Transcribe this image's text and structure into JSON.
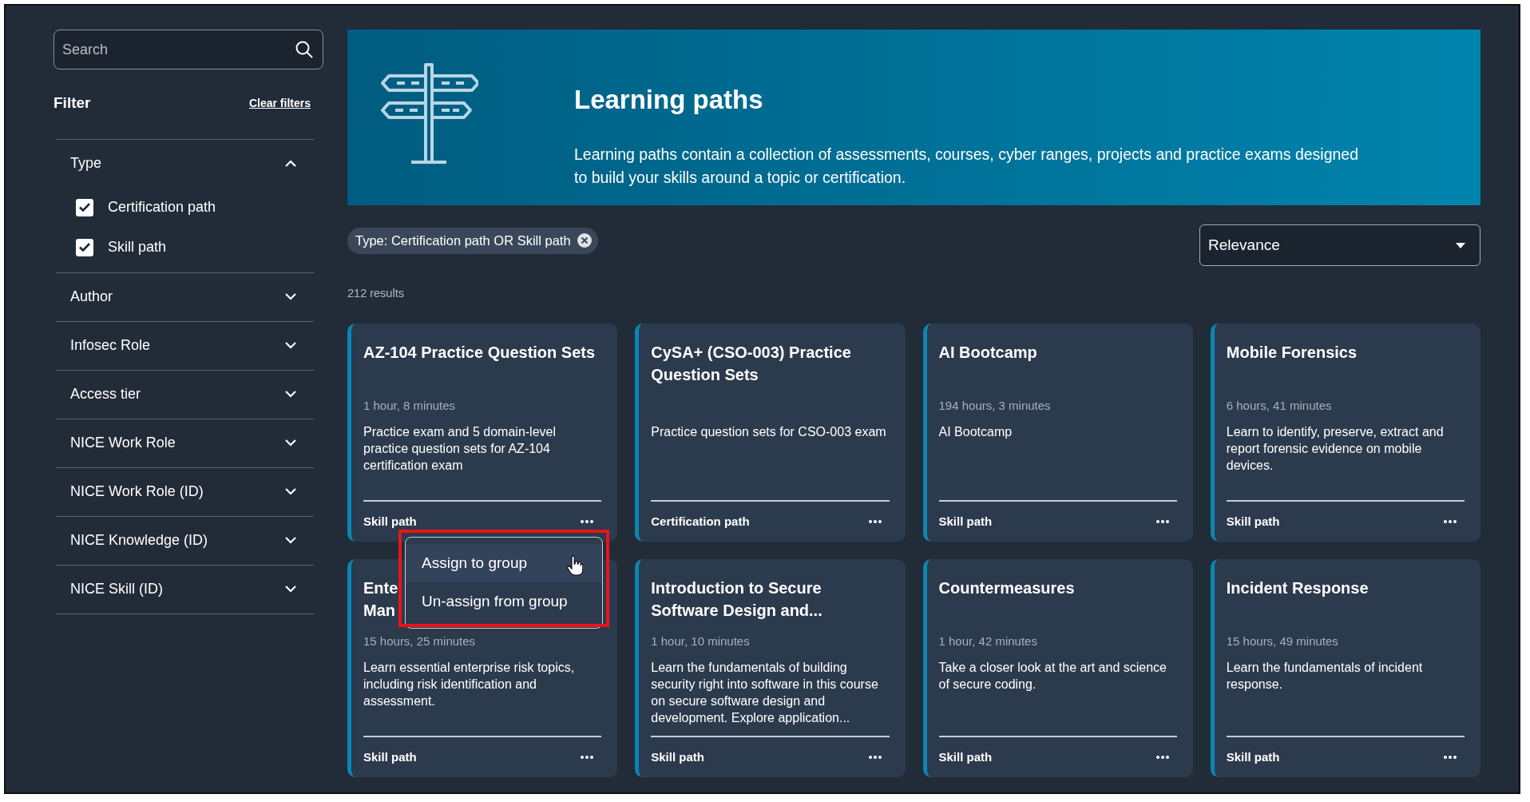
{
  "search": {
    "placeholder": "Search"
  },
  "filter": {
    "title": "Filter",
    "clear": "Clear filters"
  },
  "filter_groups": [
    {
      "label": "Type",
      "expanded": true,
      "options": [
        {
          "label": "Certification path",
          "checked": true
        },
        {
          "label": "Skill path",
          "checked": true
        }
      ]
    },
    {
      "label": "Author",
      "expanded": false
    },
    {
      "label": "Infosec Role",
      "expanded": false
    },
    {
      "label": "Access tier",
      "expanded": false
    },
    {
      "label": "NICE Work Role",
      "expanded": false
    },
    {
      "label": "NICE Work Role (ID)",
      "expanded": false
    },
    {
      "label": "NICE Knowledge (ID)",
      "expanded": false
    },
    {
      "label": "NICE Skill (ID)",
      "expanded": false
    }
  ],
  "banner": {
    "title": "Learning paths",
    "description": "Learning paths contain a collection of assessments, courses, cyber ranges, projects and practice exams designed to build your skills around a topic or certification."
  },
  "active_filters": [
    {
      "label": "Type: Certification path OR Skill path"
    }
  ],
  "sort": {
    "value": "Relevance"
  },
  "results_count": "212 results",
  "cards": [
    {
      "title": "AZ-104 Practice Question Sets",
      "duration": "1 hour, 8 minutes",
      "description": "Practice exam and 5 domain-level practice question sets for AZ-104 certification exam",
      "type": "Skill path",
      "menu": {
        "items": [
          {
            "label": "Assign to group",
            "selected": true
          },
          {
            "label": "Un-assign from group",
            "selected": false
          }
        ]
      }
    },
    {
      "title": "CySA+ (CSO-003) Practice Question Sets",
      "description": "Practice question sets for CSO-003 exam",
      "type": "Certification path"
    },
    {
      "title": "AI Bootcamp",
      "duration": "194 hours, 3 minutes",
      "description": "AI Bootcamp",
      "type": "Skill path"
    },
    {
      "title": "Mobile Forensics",
      "duration": "6 hours, 41 minutes",
      "description": "Learn to identify, preserve, extract and report forensic evidence on mobile devices.",
      "type": "Skill path"
    },
    {
      "title": "Ente\nMan",
      "duration": "15 hours, 25 minutes",
      "description": "Learn essential enterprise risk topics, including risk identification and assessment.",
      "type": "Skill path"
    },
    {
      "title": "Introduction to Secure Software Design and...",
      "duration": "1 hour, 10 minutes",
      "description": "Learn the fundamentals of building security right into software in this course on secure software design and development. Explore application...",
      "type": "Skill path"
    },
    {
      "title": "Countermeasures",
      "duration": "1 hour, 42 minutes",
      "description": "Take a closer look at the art and science of secure coding.",
      "type": "Skill path"
    },
    {
      "title": "Incident Response",
      "duration": "15 hours, 49 minutes",
      "description": "Learn the fundamentals of incident response.",
      "type": "Skill path"
    }
  ]
}
